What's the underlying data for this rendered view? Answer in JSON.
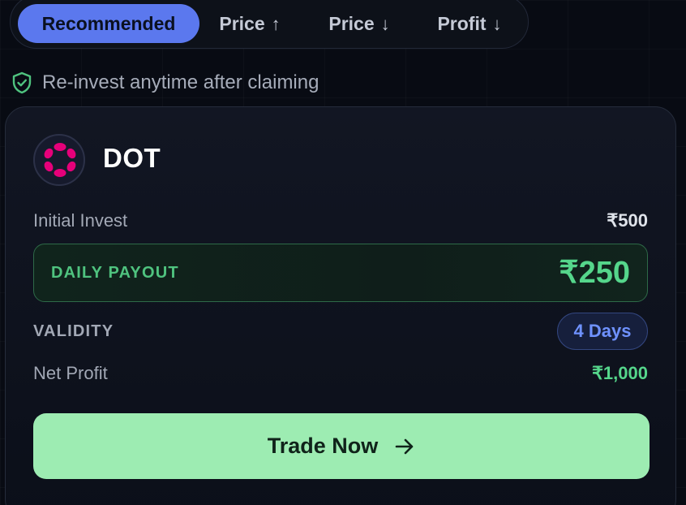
{
  "sort_tabs": [
    {
      "label": "Recommended",
      "arrow": "",
      "active": true
    },
    {
      "label": "Price",
      "arrow": "↑",
      "active": false
    },
    {
      "label": "Price",
      "arrow": "↓",
      "active": false
    },
    {
      "label": "Profit",
      "arrow": "↓",
      "active": false
    }
  ],
  "info": {
    "text": "Re-invest anytime after claiming",
    "icon": "shield-check-icon",
    "icon_color": "#4fc37f"
  },
  "card": {
    "coin_name": "DOT",
    "coin_icon": "polkadot-icon",
    "coin_color": "#e6007a",
    "initial_invest_label": "Initial Invest",
    "initial_invest_value": "₹500",
    "daily_payout_label": "DAILY PAYOUT",
    "daily_payout_value": "₹250",
    "validity_label": "VALIDITY",
    "validity_value": "4 Days",
    "net_profit_label": "Net Profit",
    "net_profit_value": "₹1,000",
    "trade_button_label": "Trade Now",
    "trade_button_icon": "arrow-right-icon"
  },
  "colors": {
    "accent_blue": "#5b78ee",
    "profit_green": "#55d68b",
    "button_green": "#9decb2"
  }
}
